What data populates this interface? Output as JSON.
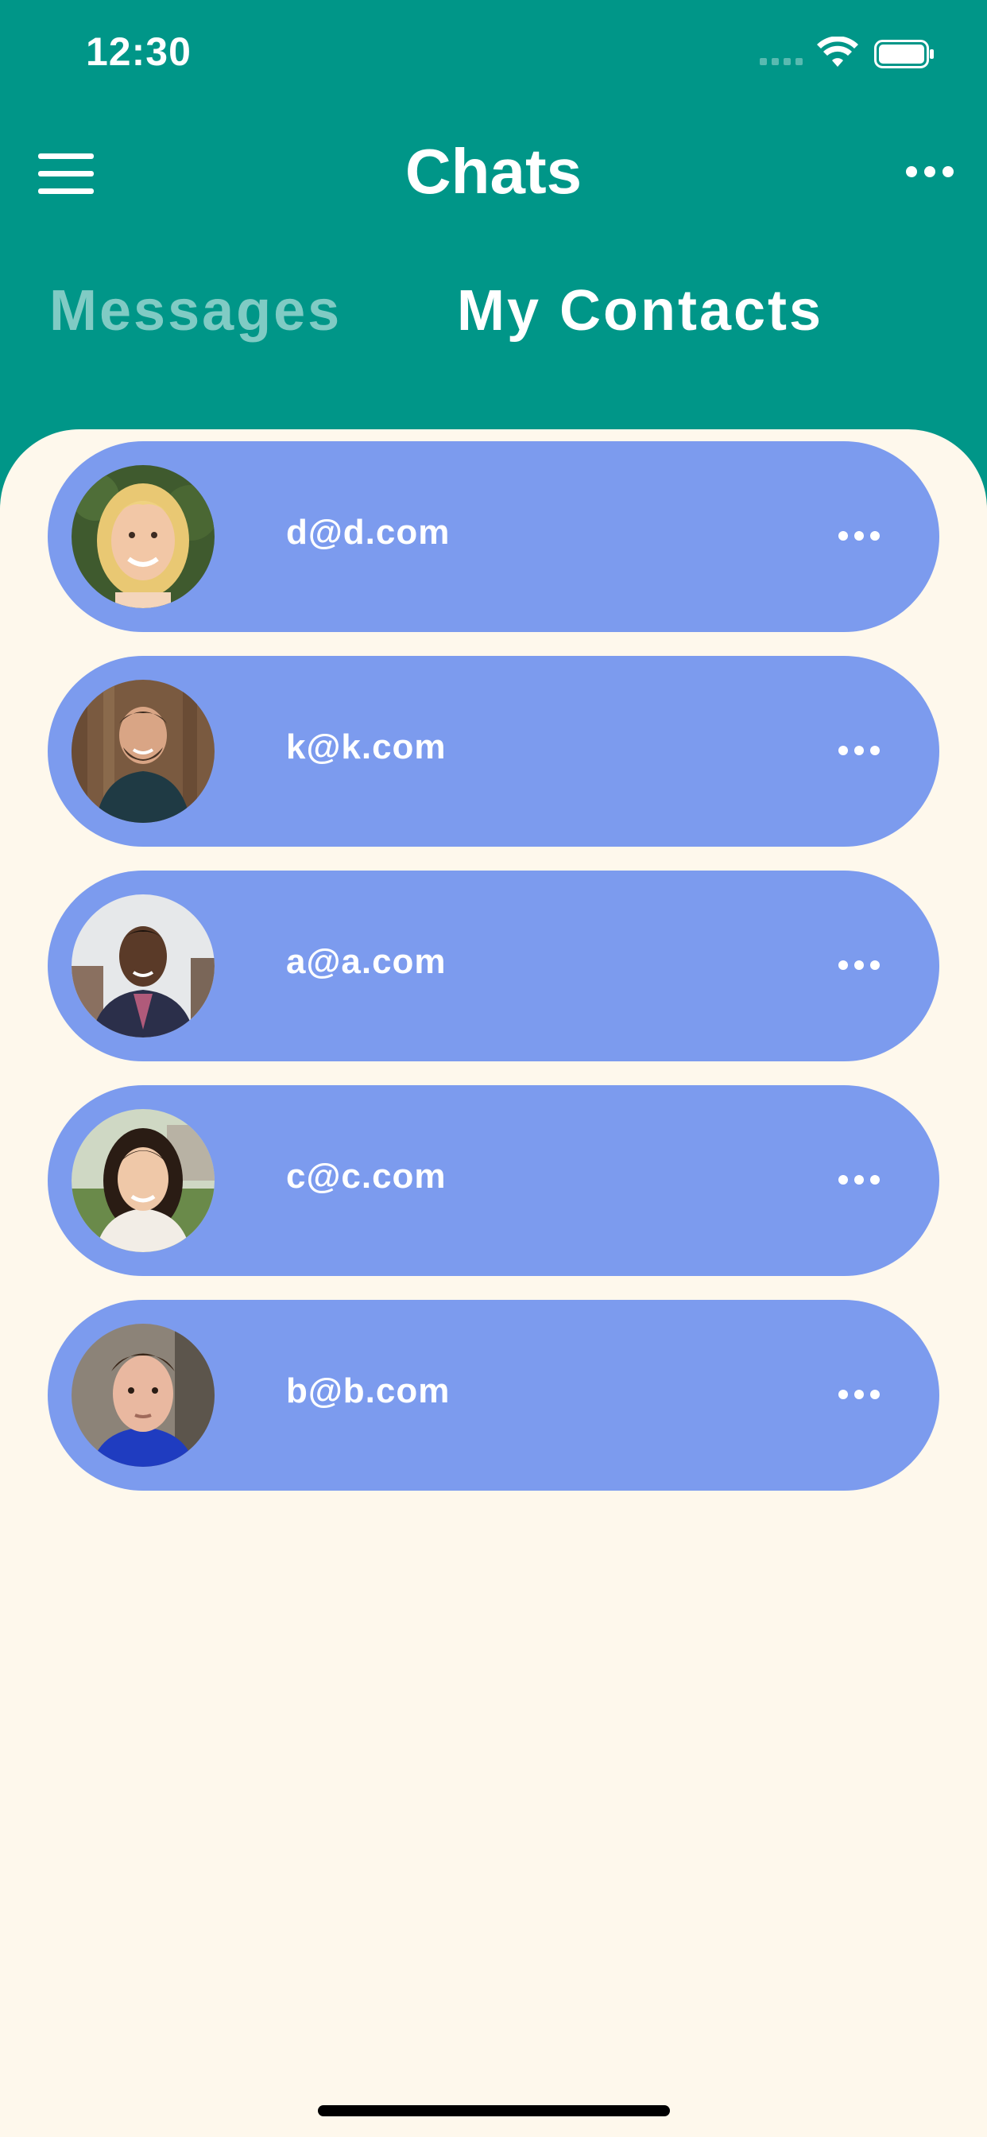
{
  "status_bar": {
    "time": "12:30"
  },
  "header": {
    "title": "Chats"
  },
  "tabs": [
    {
      "label": "Messages",
      "active": false
    },
    {
      "label": "My Contacts",
      "active": true
    }
  ],
  "contacts": [
    {
      "email": "d@d.com"
    },
    {
      "email": "k@k.com"
    },
    {
      "email": "a@a.com"
    },
    {
      "email": "c@c.com"
    },
    {
      "email": "b@b.com"
    }
  ],
  "colors": {
    "header_bg": "#009688",
    "panel_bg": "#fef8ec",
    "card_bg": "#7c9bee",
    "inactive_tab": "#80cbc4",
    "active_tab": "#ffffff"
  }
}
